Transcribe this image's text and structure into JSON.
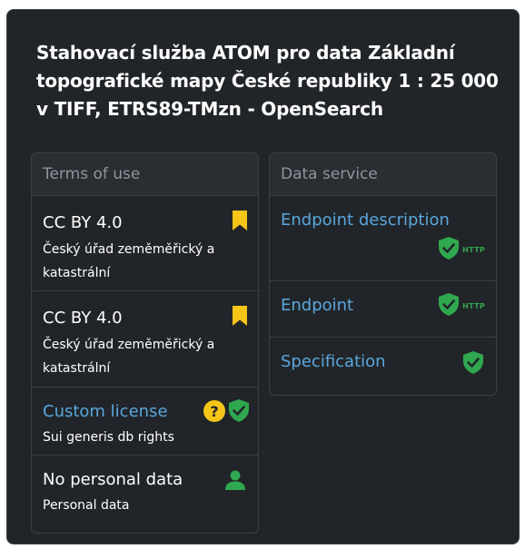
{
  "title": "Stahovací služba ATOM pro data Základní topografické mapy České republiky 1 : 25 000 v TIFF, ETRS89-TMzn - OpenSearch",
  "terms": {
    "header": "Terms of use",
    "items": [
      {
        "label": "CC BY 4.0",
        "sub": "Český úřad zeměměřický a katastrální",
        "icons": [
          "bookmark-icon"
        ]
      },
      {
        "label": "CC BY 4.0",
        "sub": "Český úřad zeměměřický a katastrální",
        "icons": [
          "bookmark-icon"
        ]
      },
      {
        "label": "Custom license",
        "sub": "Sui generis db rights",
        "icons": [
          "question-circle-icon",
          "shield-check-icon"
        ]
      },
      {
        "label": "No personal data",
        "sub": "Personal data",
        "icons": [
          "person-icon"
        ]
      }
    ]
  },
  "service": {
    "header": "Data service",
    "items": [
      {
        "label": "Endpoint description",
        "icons": [
          "shield-check-icon"
        ],
        "badge": "HTTP"
      },
      {
        "label": "Endpoint",
        "icons": [
          "shield-check-icon"
        ],
        "badge": "HTTP"
      },
      {
        "label": "Specification",
        "icons": [
          "shield-check-icon"
        ]
      }
    ]
  },
  "colors": {
    "background": "#212529",
    "link": "#5aa7dd",
    "bookmark": "#f5c518",
    "question": "#f5c518",
    "shield": "#2fa84f"
  }
}
